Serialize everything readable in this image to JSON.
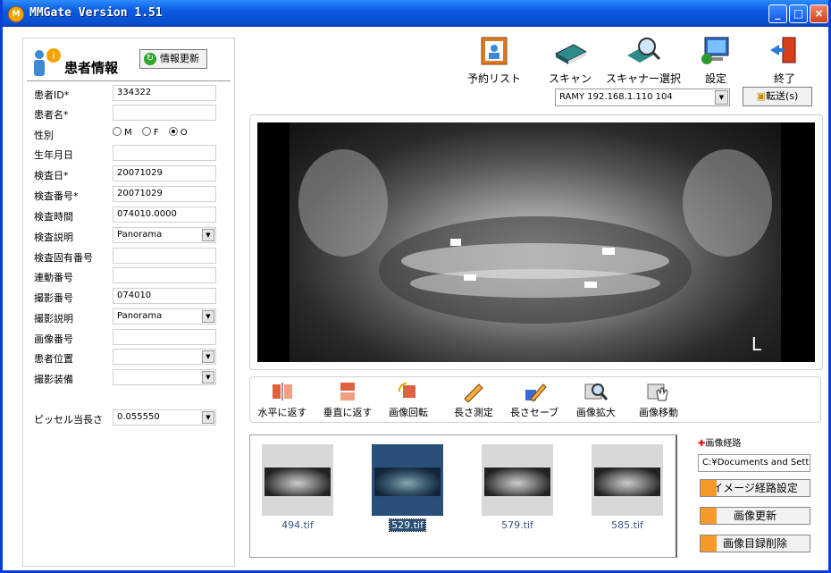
{
  "window": {
    "title": "MMGate Version 1.51",
    "icon_letter": "M",
    "minimize": "_",
    "maximize": "□",
    "close": "×"
  },
  "patient": {
    "title": "患者情報",
    "refresh_label": "情報更新",
    "fields": [
      {
        "label": "患者ID*",
        "value": ""
      },
      {
        "label": "患者名*",
        "value": ""
      },
      {
        "label": "性別",
        "value": ""
      },
      {
        "label": "生年月日",
        "value": ""
      },
      {
        "label": "検査日*",
        "value": "20071029"
      },
      {
        "label": "検査番号*",
        "value": "20071029"
      },
      {
        "label": "検査時間",
        "value": "074010.0000"
      },
      {
        "label": "検査説明",
        "value": "Panorama"
      },
      {
        "label": "検査固有番号",
        "value": ""
      },
      {
        "label": "連動番号",
        "value": ""
      },
      {
        "label": "撮影番号",
        "value": "074010"
      },
      {
        "label": "撮影説明",
        "value": "Panorama"
      },
      {
        "label": "画像番号",
        "value": ""
      },
      {
        "label": "患者位置",
        "value": ""
      },
      {
        "label": "撮影装備",
        "value": ""
      }
    ],
    "patient_id": "334322",
    "gender_options": [
      "M",
      "F",
      "O"
    ],
    "gender_selected": "O",
    "pixel_label": "ピッセル当長さ",
    "pixel_value": "0.055550"
  },
  "toolbar_top": {
    "reserve_list": "予約リスト",
    "scan": "スキャン",
    "scanner_select": "スキャナー選択",
    "settings": "設定",
    "exit": "終了"
  },
  "device": {
    "selected": "RAMY  192.168.1.110  104"
  },
  "transfer_label": "転送(s)",
  "viewer": {
    "marker": "L"
  },
  "toolbar_mid": {
    "flip_h": "水平に返す",
    "flip_v": "垂直に返す",
    "rotate": "画像回転",
    "measure": "長さ測定",
    "save_length": "長さセーブ",
    "zoom": "画像拡大",
    "move": "画像移動"
  },
  "thumbnails": [
    {
      "name": "494.tif",
      "selected": false
    },
    {
      "name": "529.tif",
      "selected": true
    },
    {
      "name": "579.tif",
      "selected": false
    },
    {
      "name": "585.tif",
      "selected": false
    }
  ],
  "side": {
    "path_label": "画像経路",
    "path_value": "C:¥Documents and Settings",
    "set_path": "イメージ経路設定",
    "refresh_images": "画像更新",
    "delete_list": "画像目録削除"
  },
  "colors": {
    "titlebar": "#0a5ae0",
    "accent_orange": "#f59a2a",
    "selection": "#2a4f78"
  }
}
